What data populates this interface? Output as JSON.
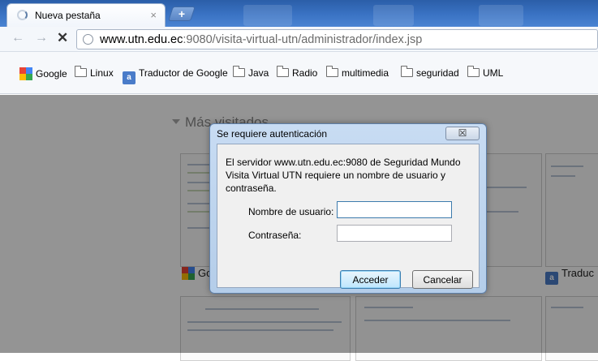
{
  "tab": {
    "title": "Nueva pestaña",
    "close": "×",
    "newtab": "+"
  },
  "toolbar": {
    "url_host": "www.utn.edu.ec",
    "url_rest": ":9080/visita-virtual-utn/administrador/index.jsp"
  },
  "bookmarks": {
    "items": [
      {
        "label": "Google",
        "icon": "google-icon"
      },
      {
        "label": "Linux",
        "icon": "folder-icon"
      },
      {
        "label": "Traductor de Google",
        "icon": "translate-icon"
      },
      {
        "label": "Java",
        "icon": "folder-icon"
      },
      {
        "label": "Radio",
        "icon": "folder-icon"
      },
      {
        "label": "multimedia",
        "icon": "folder-icon"
      },
      {
        "label": "seguridad",
        "icon": "folder-icon"
      },
      {
        "label": "UML",
        "icon": "folder-icon"
      }
    ]
  },
  "newtab": {
    "heading": "Más visitados",
    "thumbs": [
      {
        "caption": "Go"
      },
      {
        "caption": ""
      },
      {
        "caption": "Traduc"
      }
    ]
  },
  "dialog": {
    "title": "Se requiere autenticación",
    "close_glyph": "☒",
    "message": "El servidor www.utn.edu.ec:9080 de Seguridad Mundo Visita Virtual UTN requiere un nombre de usuario y contraseña.",
    "username_label": "Nombre de usuario:",
    "password_label": "Contraseña:",
    "username_value": "",
    "password_value": "",
    "submit_label": "Acceder",
    "cancel_label": "Cancelar"
  }
}
